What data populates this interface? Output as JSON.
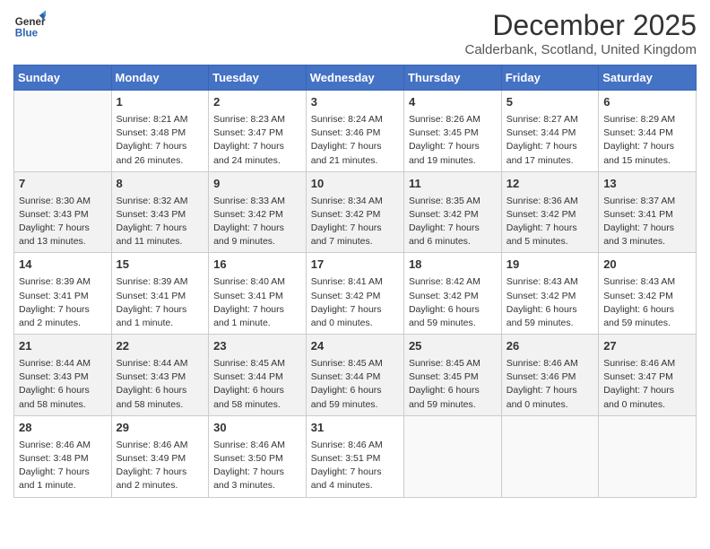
{
  "header": {
    "logo_general": "General",
    "logo_blue": "Blue",
    "month_title": "December 2025",
    "location": "Calderbank, Scotland, United Kingdom"
  },
  "columns": [
    "Sunday",
    "Monday",
    "Tuesday",
    "Wednesday",
    "Thursday",
    "Friday",
    "Saturday"
  ],
  "rows": [
    [
      {
        "day": "",
        "info": ""
      },
      {
        "day": "1",
        "info": "Sunrise: 8:21 AM\nSunset: 3:48 PM\nDaylight: 7 hours\nand 26 minutes."
      },
      {
        "day": "2",
        "info": "Sunrise: 8:23 AM\nSunset: 3:47 PM\nDaylight: 7 hours\nand 24 minutes."
      },
      {
        "day": "3",
        "info": "Sunrise: 8:24 AM\nSunset: 3:46 PM\nDaylight: 7 hours\nand 21 minutes."
      },
      {
        "day": "4",
        "info": "Sunrise: 8:26 AM\nSunset: 3:45 PM\nDaylight: 7 hours\nand 19 minutes."
      },
      {
        "day": "5",
        "info": "Sunrise: 8:27 AM\nSunset: 3:44 PM\nDaylight: 7 hours\nand 17 minutes."
      },
      {
        "day": "6",
        "info": "Sunrise: 8:29 AM\nSunset: 3:44 PM\nDaylight: 7 hours\nand 15 minutes."
      }
    ],
    [
      {
        "day": "7",
        "info": "Sunrise: 8:30 AM\nSunset: 3:43 PM\nDaylight: 7 hours\nand 13 minutes."
      },
      {
        "day": "8",
        "info": "Sunrise: 8:32 AM\nSunset: 3:43 PM\nDaylight: 7 hours\nand 11 minutes."
      },
      {
        "day": "9",
        "info": "Sunrise: 8:33 AM\nSunset: 3:42 PM\nDaylight: 7 hours\nand 9 minutes."
      },
      {
        "day": "10",
        "info": "Sunrise: 8:34 AM\nSunset: 3:42 PM\nDaylight: 7 hours\nand 7 minutes."
      },
      {
        "day": "11",
        "info": "Sunrise: 8:35 AM\nSunset: 3:42 PM\nDaylight: 7 hours\nand 6 minutes."
      },
      {
        "day": "12",
        "info": "Sunrise: 8:36 AM\nSunset: 3:42 PM\nDaylight: 7 hours\nand 5 minutes."
      },
      {
        "day": "13",
        "info": "Sunrise: 8:37 AM\nSunset: 3:41 PM\nDaylight: 7 hours\nand 3 minutes."
      }
    ],
    [
      {
        "day": "14",
        "info": "Sunrise: 8:39 AM\nSunset: 3:41 PM\nDaylight: 7 hours\nand 2 minutes."
      },
      {
        "day": "15",
        "info": "Sunrise: 8:39 AM\nSunset: 3:41 PM\nDaylight: 7 hours\nand 1 minute."
      },
      {
        "day": "16",
        "info": "Sunrise: 8:40 AM\nSunset: 3:41 PM\nDaylight: 7 hours\nand 1 minute."
      },
      {
        "day": "17",
        "info": "Sunrise: 8:41 AM\nSunset: 3:42 PM\nDaylight: 7 hours\nand 0 minutes."
      },
      {
        "day": "18",
        "info": "Sunrise: 8:42 AM\nSunset: 3:42 PM\nDaylight: 6 hours\nand 59 minutes."
      },
      {
        "day": "19",
        "info": "Sunrise: 8:43 AM\nSunset: 3:42 PM\nDaylight: 6 hours\nand 59 minutes."
      },
      {
        "day": "20",
        "info": "Sunrise: 8:43 AM\nSunset: 3:42 PM\nDaylight: 6 hours\nand 59 minutes."
      }
    ],
    [
      {
        "day": "21",
        "info": "Sunrise: 8:44 AM\nSunset: 3:43 PM\nDaylight: 6 hours\nand 58 minutes."
      },
      {
        "day": "22",
        "info": "Sunrise: 8:44 AM\nSunset: 3:43 PM\nDaylight: 6 hours\nand 58 minutes."
      },
      {
        "day": "23",
        "info": "Sunrise: 8:45 AM\nSunset: 3:44 PM\nDaylight: 6 hours\nand 58 minutes."
      },
      {
        "day": "24",
        "info": "Sunrise: 8:45 AM\nSunset: 3:44 PM\nDaylight: 6 hours\nand 59 minutes."
      },
      {
        "day": "25",
        "info": "Sunrise: 8:45 AM\nSunset: 3:45 PM\nDaylight: 6 hours\nand 59 minutes."
      },
      {
        "day": "26",
        "info": "Sunrise: 8:46 AM\nSunset: 3:46 PM\nDaylight: 7 hours\nand 0 minutes."
      },
      {
        "day": "27",
        "info": "Sunrise: 8:46 AM\nSunset: 3:47 PM\nDaylight: 7 hours\nand 0 minutes."
      }
    ],
    [
      {
        "day": "28",
        "info": "Sunrise: 8:46 AM\nSunset: 3:48 PM\nDaylight: 7 hours\nand 1 minute."
      },
      {
        "day": "29",
        "info": "Sunrise: 8:46 AM\nSunset: 3:49 PM\nDaylight: 7 hours\nand 2 minutes."
      },
      {
        "day": "30",
        "info": "Sunrise: 8:46 AM\nSunset: 3:50 PM\nDaylight: 7 hours\nand 3 minutes."
      },
      {
        "day": "31",
        "info": "Sunrise: 8:46 AM\nSunset: 3:51 PM\nDaylight: 7 hours\nand 4 minutes."
      },
      {
        "day": "",
        "info": ""
      },
      {
        "day": "",
        "info": ""
      },
      {
        "day": "",
        "info": ""
      }
    ]
  ]
}
